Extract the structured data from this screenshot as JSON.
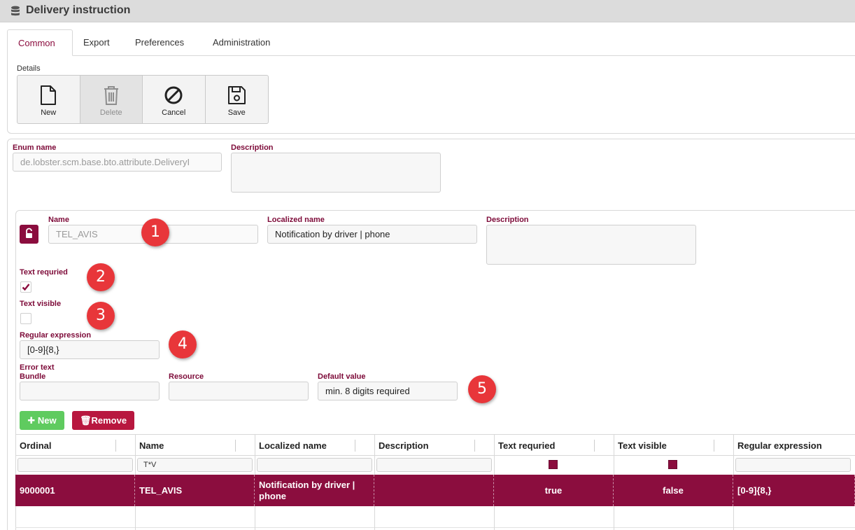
{
  "window": {
    "title": "Delivery instruction",
    "icon": "database-icon"
  },
  "tabs": [
    {
      "label": "Common",
      "active": true
    },
    {
      "label": "Export",
      "active": false
    },
    {
      "label": "Preferences",
      "active": false
    },
    {
      "label": "Administration",
      "active": false
    }
  ],
  "details": {
    "label": "Details",
    "toolbar": [
      {
        "label": "New",
        "icon": "file-icon",
        "enabled": true
      },
      {
        "label": "Delete",
        "icon": "trash-icon",
        "enabled": false
      },
      {
        "label": "Cancel",
        "icon": "ban-icon",
        "enabled": true
      },
      {
        "label": "Save",
        "icon": "floppy-disk-icon",
        "enabled": true
      }
    ]
  },
  "enum": {
    "name_label": "Enum name",
    "name_value": "de.lobster.scm.base.bto.attribute.DeliveryI",
    "description_label": "Description",
    "description_value": ""
  },
  "entry": {
    "name_label": "Name",
    "name_value": "TEL_AVIS",
    "localized_label": "Localized name",
    "localized_value": "Notification by driver | phone",
    "description_label": "Description",
    "description_value": "",
    "text_required_label": "Text requried",
    "text_required": true,
    "text_visible_label": "Text visible",
    "text_visible": false,
    "regex_label": "Regular expression",
    "regex_value": "[0-9]{8,}",
    "error_text_label": "Error text",
    "bundle_label": "Bundle",
    "bundle_value": "",
    "resource_label": "Resource",
    "resource_value": "",
    "default_label": "Default value",
    "default_value": "min. 8 digits required"
  },
  "annotations": [
    "1",
    "2",
    "3",
    "4",
    "5"
  ],
  "buttons": {
    "new_label": "New",
    "remove_label": "Remove"
  },
  "grid": {
    "columns": [
      "Ordinal",
      "Name",
      "Localized name",
      "Description",
      "Text requried",
      "Text visible",
      "Regular expression"
    ],
    "filters": {
      "name": "T*V"
    },
    "rows": [
      {
        "ordinal": "9000001",
        "name": "TEL_AVIS",
        "localized_name": "Notification by driver | phone",
        "description": "",
        "text_required": "true",
        "text_visible": "false",
        "regex": "[0-9]{8,}"
      }
    ]
  },
  "colors": {
    "accent": "#8b0d3e",
    "badge": "#e8363a",
    "new_button": "#5fcb5f",
    "remove_button": "#b8173f"
  }
}
